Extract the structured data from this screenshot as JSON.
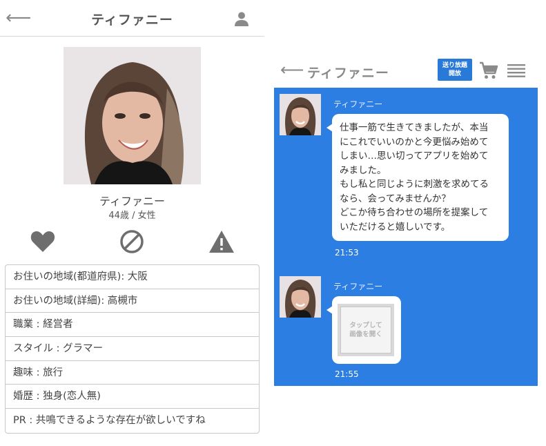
{
  "profile": {
    "header": {
      "back_icon": "back-arrow-icon",
      "back_glyph": "⟵",
      "title": "ティファニー",
      "user_icon": "user-icon"
    },
    "name": "ティファニー",
    "age_gender": "44歳 / 女性",
    "actions": [
      {
        "icon": "heart-icon"
      },
      {
        "icon": "block-icon"
      },
      {
        "icon": "warning-icon"
      }
    ],
    "info": [
      "お住いの地域(都道府県): 大阪",
      "お住いの地域(詳細): 高槻市",
      "職業 : 経営者",
      "スタイル : グラマー",
      "趣味 : 旅行",
      "婚歴 : 独身(恋人無)",
      "PR : 共鳴できるような存在が欲しいですね"
    ]
  },
  "chat": {
    "header": {
      "back_glyph": "⟵",
      "title": "ティファニー",
      "badge_line1": "送り放題",
      "badge_line2": "開放",
      "cart_icon": "cart-icon",
      "menu_icon": "menu-icon"
    },
    "messages": [
      {
        "sender": "ティファニー",
        "text": "仕事一筋で生きてきましたが、本当\nにこれでいいのかと今更悩み始めて\nしまい…思い切ってアプリを始めて\nみました。\nもし私と同じように刺激を求めてる\nなら、会ってみませんか？\nどこか待ち合わせの場所を提案して\nいただけると嬉しいです。",
        "time": "21:53"
      },
      {
        "sender": "ティファニー",
        "image_label_line1": "タップして",
        "image_label_line2": "画像を開く",
        "time": "21:55"
      }
    ]
  },
  "colors": {
    "chat_background": "#2c7ee2",
    "badge": "#2979d9",
    "icon_gray": "#888888"
  }
}
